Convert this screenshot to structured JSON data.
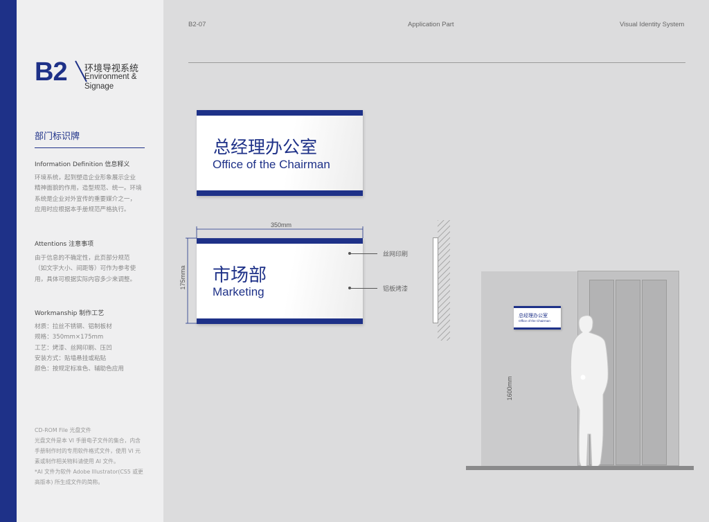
{
  "header": {
    "page_code": "B2-07",
    "part": "Application Part",
    "system": "Visual Identity System"
  },
  "section": {
    "code": "B2",
    "name_cn": "环境导视系统",
    "name_en_line1": "Environment &",
    "name_en_line2": "Signage"
  },
  "page_heading": "部门标识牌",
  "info": {
    "title": "Information Definition 信息释义",
    "lines": [
      "环境系统，起到塑造企业形象展示企业",
      "精神面貌的作用，造型规范、统一。环境",
      "系统是企业对外宣传的重要媒介之一，",
      "应用时应根据本手册规范严格执行。"
    ]
  },
  "attentions": {
    "title": "Attentions 注意事项",
    "lines": [
      "由于信息的不确定性，此页部分规范",
      "（如文字大小、间距等）可作为参考使",
      "用，具体可根据实际内容多少来调整。"
    ]
  },
  "workmanship": {
    "title": "Workmanship  制作工艺",
    "lines": [
      "材质：拉丝不锈钢、铝制板材",
      "规格：350mm×175mm",
      "工艺：烤漆、丝网印刷、压凹",
      "安装方式：贴墙悬挂或粘贴",
      "颜色：按规定标准色、辅助色应用"
    ]
  },
  "cdrom": {
    "title": "CD-ROM File 光盘文件",
    "lines": [
      "光盘文件是本 VI 手册电子文件的集合，内含",
      "手册制作时的专用软件格式文件，使用 VI 元",
      "素或制作相关物料请使用 AI 文件。",
      "*AI 文件为软件 Adobe Illustrator(CS5 或更",
      "高版本) 所生成文件的简称。"
    ]
  },
  "sign1": {
    "cn": "总经理办公室",
    "en": "Office of the Chairman"
  },
  "sign2": {
    "cn": "市场部",
    "en": "Marketing"
  },
  "dimensions": {
    "width": "350mm",
    "height": "175mma",
    "mount_height": "1600mm"
  },
  "annotations": {
    "print": "丝网印刷",
    "paint": "铝板烤漆"
  },
  "scene_sign": {
    "cn": "总经理办公室",
    "en": "Office of the Chairman"
  },
  "colors": {
    "brand_blue": "#1e3188",
    "background": "#dcdcdd",
    "sidebar": "#efeff0"
  }
}
